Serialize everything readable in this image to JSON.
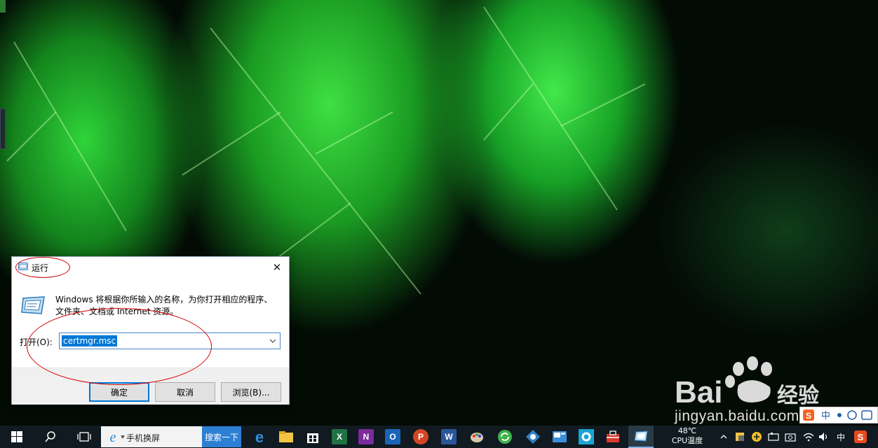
{
  "run_dialog": {
    "title": "运行",
    "description": "Windows 将根据你所输入的名称，为你打开相应的程序、文件夹、文档或 Internet 资源。",
    "open_label": "打开(O):",
    "input_value": "certmgr.msc",
    "buttons": {
      "ok": "确定",
      "cancel": "取消",
      "browse": "浏览(B)..."
    }
  },
  "watermark": {
    "text": "jingyan.baidu.com"
  },
  "taskbar": {
    "search_text": "手机换屏",
    "search_button": "搜索一下",
    "temperature": "48℃",
    "temperature_label": "CPU温度",
    "ime": "中",
    "pinned_apps": [
      "edge-icon",
      "file-explorer-icon",
      "store-icon",
      "excel-icon",
      "onenote-icon",
      "outlook-icon",
      "powerpoint-icon",
      "word-icon",
      "paint-icon",
      "refresh-app-icon",
      "diagram-app-icon",
      "photo-app-icon",
      "settings-icon",
      "toolbox-icon",
      "run-app-icon"
    ]
  },
  "colors": {
    "accent": "#0078d7",
    "taskbar": "#101a20",
    "annotation": "#d40000"
  }
}
